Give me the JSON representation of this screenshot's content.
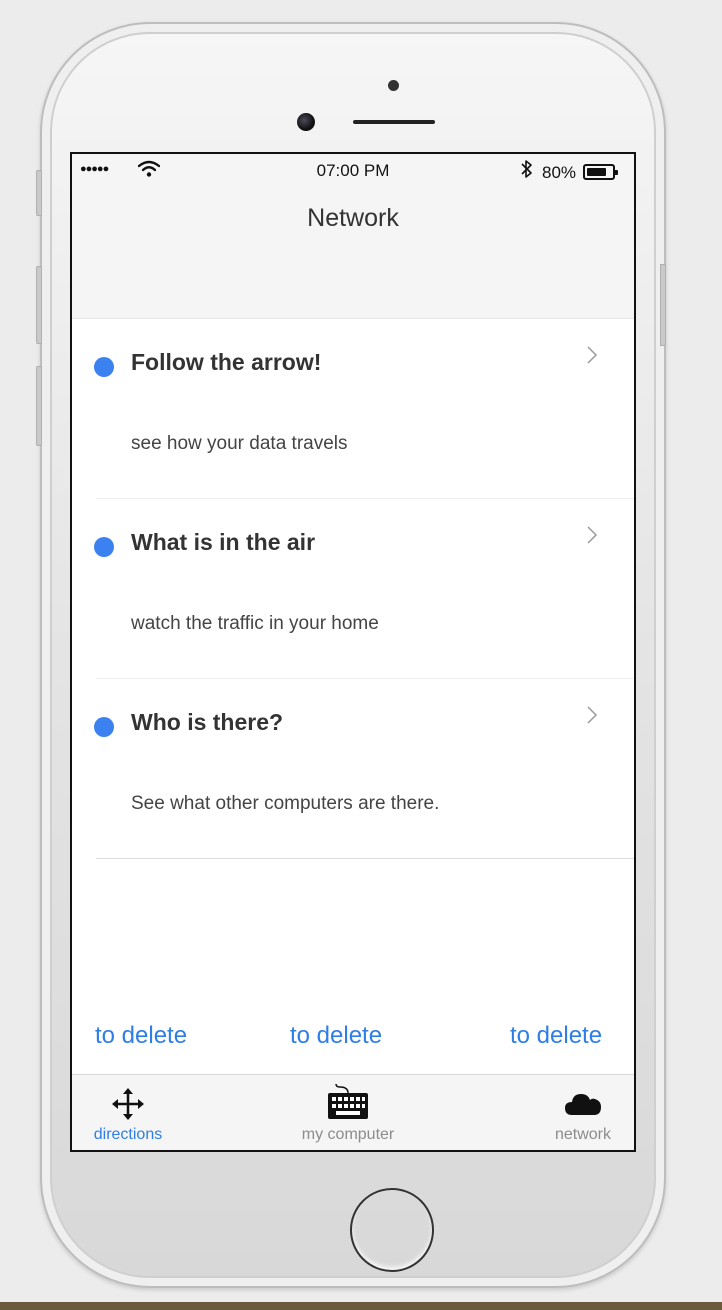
{
  "status_bar": {
    "signal": "●●●●●",
    "time": "07:00 PM",
    "battery_percent": "80%",
    "battery_level": 0.8
  },
  "nav": {
    "title": "Network"
  },
  "items": [
    {
      "title": "Follow the arrow!",
      "subtitle": "see how your data travels"
    },
    {
      "title": "What is in the air",
      "subtitle": "watch the traffic in your home"
    },
    {
      "title": "Who is there?",
      "subtitle": "See what other computers are there."
    }
  ],
  "actions": [
    "to delete",
    "to delete",
    "to delete"
  ],
  "tabs": [
    {
      "label": "directions",
      "icon": "move-arrows-icon",
      "active": true
    },
    {
      "label": "my computer",
      "icon": "keyboard-icon",
      "active": false
    },
    {
      "label": "network",
      "icon": "cloud-icon",
      "active": false
    }
  ],
  "colors": {
    "accent": "#2f7ee8",
    "dot": "#3b82f0",
    "tab_inactive": "#8c8c8c"
  }
}
